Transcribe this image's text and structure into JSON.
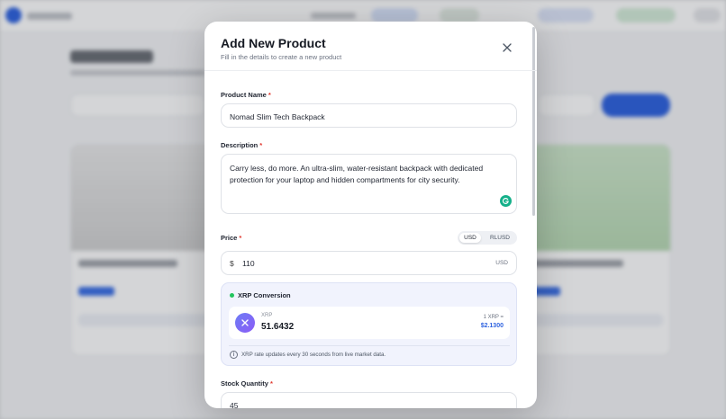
{
  "modal": {
    "title": "Add New Product",
    "subtitle": "Fill in the details to create a new product"
  },
  "form": {
    "name_label": "Product Name",
    "name_value": "Nomad Slim Tech Backpack",
    "description_label": "Description",
    "description_value": "Carry less, do more. An ultra-slim, water-resistant backpack with dedicated protection for your laptop and hidden compartments for city security.",
    "price_label": "Price",
    "price_symbol": "$",
    "price_value": "110",
    "price_currency": "USD",
    "currency_options": [
      "USD",
      "RLUSD"
    ],
    "selected_currency": "USD",
    "stock_label": "Stock Quantity",
    "stock_value": "45",
    "required_marker": "*"
  },
  "xrp": {
    "title": "XRP Conversion",
    "label": "XRP",
    "amount": "51.6432",
    "rate_prefix": "1 XRP =",
    "rate_value": "$2.1300",
    "note": "XRP rate updates every 30 seconds from live market data."
  },
  "colors": {
    "accent": "#2f63e0",
    "required": "#e0362c",
    "live": "#22c55e",
    "xrp_panel": "#f1f3fd"
  },
  "icons": {
    "close": "close-icon",
    "xrp": "xrp-logo-icon",
    "info": "info-icon",
    "grammarly": "grammarly-icon"
  }
}
